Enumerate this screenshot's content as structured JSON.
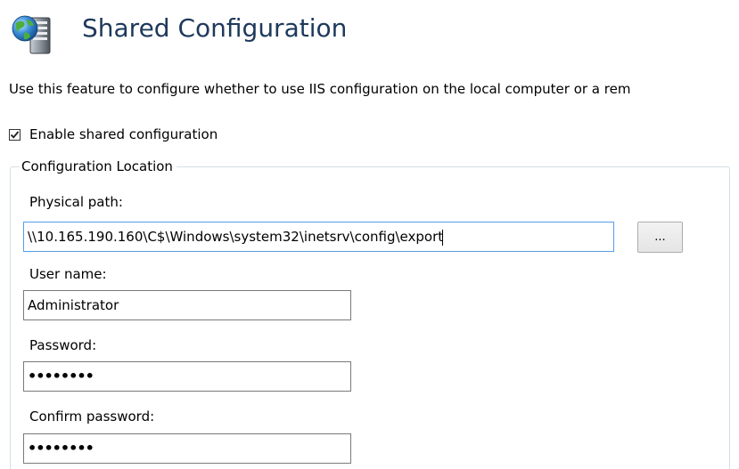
{
  "header": {
    "icon": "globe-server-icon",
    "title": "Shared Configuration"
  },
  "description": "Use this feature to configure whether to use IIS configuration on the local computer or a rem",
  "enable_shared": {
    "checked": true,
    "label": "Enable shared configuration"
  },
  "config_location": {
    "legend": "Configuration Location",
    "physical_path": {
      "label": "Physical path:",
      "value": "\\\\10.165.190.160\\C$\\Windows\\system32\\inetsrv\\config\\export",
      "browse_label": "..."
    },
    "user_name": {
      "label": "User name:",
      "value": "Administrator"
    },
    "password": {
      "label": "Password:",
      "value": "••••••••"
    },
    "confirm_password": {
      "label": "Confirm password:",
      "value": "••••••••"
    }
  }
}
